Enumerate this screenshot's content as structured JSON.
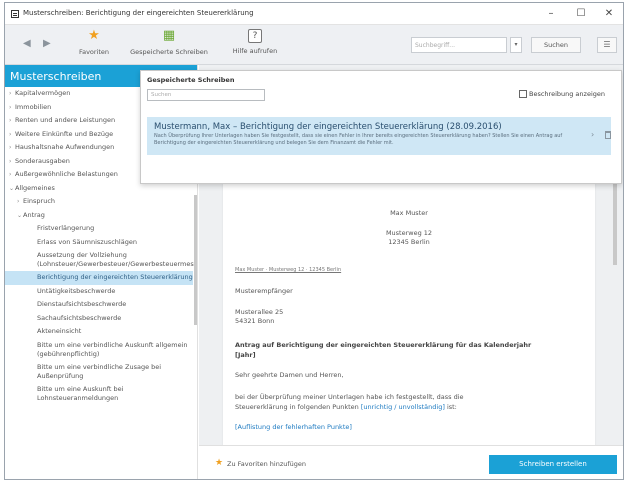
{
  "window": {
    "title": "Musterschreiben: Berichtigung der eingereichten Steuererklärung",
    "minimize": "–",
    "maximize": "☐",
    "close": "✕"
  },
  "toolbar": {
    "back": "◀",
    "forward": "▶",
    "favorites_label": "Favoriten",
    "saved_label": "Gespeicherte Schreiben",
    "help_label": "Hilfe aufrufen",
    "help_glyph": "?",
    "search_placeholder": "Suchbegriff...",
    "search_button": "Suchen",
    "dropdown_glyph": "▾",
    "menu_glyph": "☰"
  },
  "sidebar": {
    "header": "Musterschreiben",
    "items": [
      {
        "label": "Kapitalvermögen",
        "level": 0,
        "arrow": "›"
      },
      {
        "label": "Immobilien",
        "level": 0,
        "arrow": "›"
      },
      {
        "label": "Renten und andere Leistungen",
        "level": 0,
        "arrow": "›"
      },
      {
        "label": "Weitere Einkünfte und Bezüge",
        "level": 0,
        "arrow": "›"
      },
      {
        "label": "Haushaltsnahe Aufwendungen",
        "level": 0,
        "arrow": "›"
      },
      {
        "label": "Sonderausgaben",
        "level": 0,
        "arrow": "›"
      },
      {
        "label": "Außergewöhnliche Belastungen",
        "level": 0,
        "arrow": "›"
      },
      {
        "label": "Allgemeines",
        "level": 0,
        "arrow": "⌄"
      },
      {
        "label": "Einspruch",
        "level": 1,
        "arrow": "›"
      },
      {
        "label": "Antrag",
        "level": 1,
        "arrow": "⌄"
      },
      {
        "label": "Fristverlängerung",
        "level": 2,
        "arrow": ""
      },
      {
        "label": "Erlass von Säumniszuschlägen",
        "level": 2,
        "arrow": ""
      },
      {
        "label": "Aussetzung der Vollziehung (Lohnsteuer/Gewerbesteuer/Gewerbesteuermessbetrag)",
        "level": 2,
        "arrow": ""
      },
      {
        "label": "Berichtigung der eingereichten Steuererklärung",
        "level": 2,
        "arrow": "",
        "selected": true
      },
      {
        "label": "Untätigkeitsbeschwerde",
        "level": 2,
        "arrow": ""
      },
      {
        "label": "Dienstaufsichtsbeschwerde",
        "level": 2,
        "arrow": ""
      },
      {
        "label": "Sachaufsichtsbeschwerde",
        "level": 2,
        "arrow": ""
      },
      {
        "label": "Akteneinsicht",
        "level": 2,
        "arrow": ""
      },
      {
        "label": "Bitte um eine verbindliche Auskunft allgemein (gebührenpflichtig)",
        "level": 2,
        "arrow": ""
      },
      {
        "label": "Bitte um eine verbindliche Zusage bei Außenprüfung",
        "level": 2,
        "arrow": ""
      },
      {
        "label": "Bitte um eine Auskunft bei Lohnsteueranmeldungen",
        "level": 2,
        "arrow": ""
      }
    ]
  },
  "popup": {
    "title": "Gespeicherte Schreiben",
    "search_placeholder": "Suchen",
    "checkbox_label": "Beschreibung anzeigen",
    "entry_title": "Mustermann, Max – Berichtigung der eingereichten Steuererklärung (28.09.2016)",
    "entry_desc": "Nach Überprüfung Ihrer Unterlagen haben Sie festgestellt, dass sie einen Fehler in Ihrer bereits eingereichten Steuererklärung haben? Stellen Sie einen Antrag auf Berichtigung der eingereichten Steuererklärung und belegen Sie dem Finanzamt die Fehler mit.",
    "entry_chevron": "›"
  },
  "document": {
    "sender_name": "Max Muster",
    "sender_street": "Musterweg 12",
    "sender_city": "12345 Berlin",
    "return_line": "Max Muster · Musterweg 12 · 12345 Berlin",
    "recipient_name": "Musterempfänger",
    "recipient_street": "Musterallee 25",
    "recipient_city": "54321 Bonn",
    "subject_1": "Antrag auf Berichtigung der eingereichten Steuererklärung für das Kalenderjahr",
    "subject_2": "[Jahr]",
    "greeting": "Sehr geehrte Damen und Herren,",
    "body_1": "bei der Überprüfung meiner Unterlagen habe ich festgestellt, dass die",
    "body_2_prefix": "Steuererklärung in folgenden Punkten ",
    "body_2_link": "[unrichtig / unvollständig]",
    "body_2_suffix": " ist:",
    "body_3_link": "[Auflistung der fehlerhaften Punkte]"
  },
  "bottom": {
    "favorite_label": "Zu Favoriten hinzufügen",
    "create_button": "Schreiben erstellen"
  },
  "colors": {
    "accent": "#1ba1d6",
    "selection": "#c5e3f5",
    "popup_entry": "#cfe7f5"
  }
}
